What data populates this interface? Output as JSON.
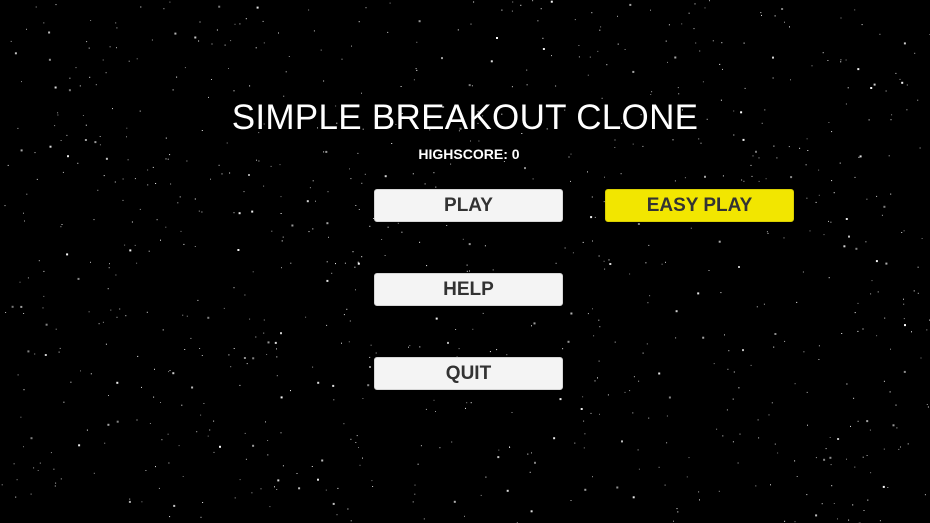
{
  "game": {
    "title": "SIMPLE BREAKOUT CLONE",
    "highscore_label": "HIGHSCORE:",
    "highscore_value": "0"
  },
  "menu": {
    "play_label": "PLAY",
    "easy_play_label": "EASY PLAY",
    "help_label": "HELP",
    "quit_label": "QUIT"
  },
  "colors": {
    "background": "#000000",
    "button": "#f4f4f4",
    "easy_button": "#f2e600",
    "button_text": "#333333",
    "title_text": "#ffffff"
  }
}
